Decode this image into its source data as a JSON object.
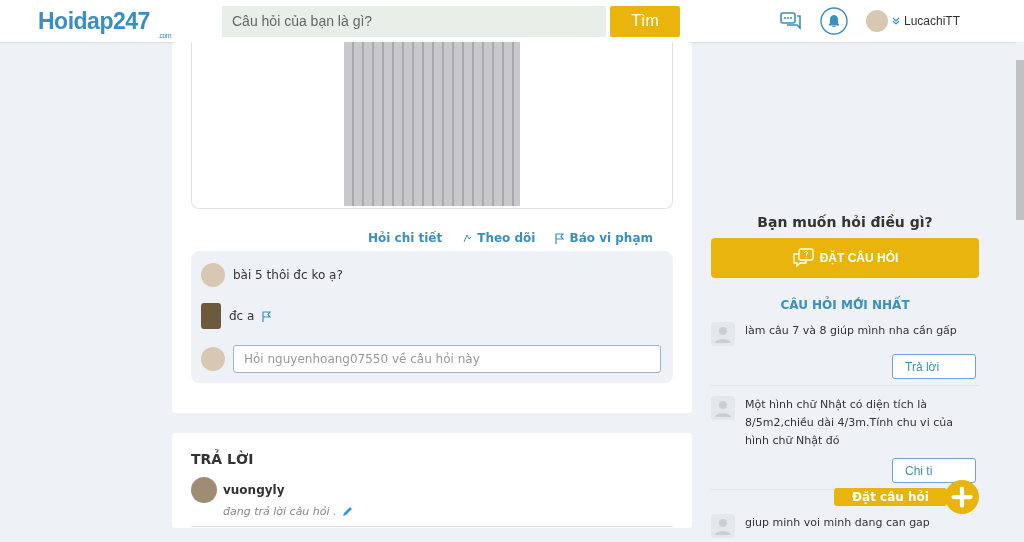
{
  "header": {
    "logo": "Hoidap247",
    "logo_sub": ".com",
    "search": {
      "placeholder": "Câu hỏi của bạn là gì?"
    },
    "search_button": "Tìm",
    "user": "LucachiTT"
  },
  "question": {
    "actions": [
      {
        "label": "Hỏi chi tiết"
      },
      {
        "label": "Theo dõi"
      },
      {
        "label": "Báo vi phạm"
      }
    ],
    "comments": [
      {
        "text": "bài 5 thôi đc ko ạ?",
        "flag": false
      },
      {
        "text": "đc a",
        "flag": true
      }
    ],
    "comment_field": {
      "placeholder": "Hỏi nguyenhoang07550 về câu hỏi này"
    }
  },
  "answers": {
    "title": "TRẢ LỜI",
    "user": "vuongyly",
    "status": "đang trả lời câu hỏi ."
  },
  "sidebar": {
    "prompt": "Bạn muốn hỏi điều gì?",
    "ask_button": "ĐẶT CÂU HỎI",
    "latest_title": "CÂU HỎI MỚI NHẤT",
    "questions": [
      {
        "text": "làm câu 7 và 8 giúp mình nha cần gấp",
        "button": "Trả lời"
      },
      {
        "text": "Một hình chữ Nhật có diện tích là 8/5m2,chiều dài 4/3m.Tính chu vi của hình chữ Nhật đó",
        "button": "Chi ti"
      },
      {
        "text": "giup minh voi minh dang can gap"
      }
    ]
  },
  "floating": {
    "label": "Đặt câu hỏi"
  }
}
